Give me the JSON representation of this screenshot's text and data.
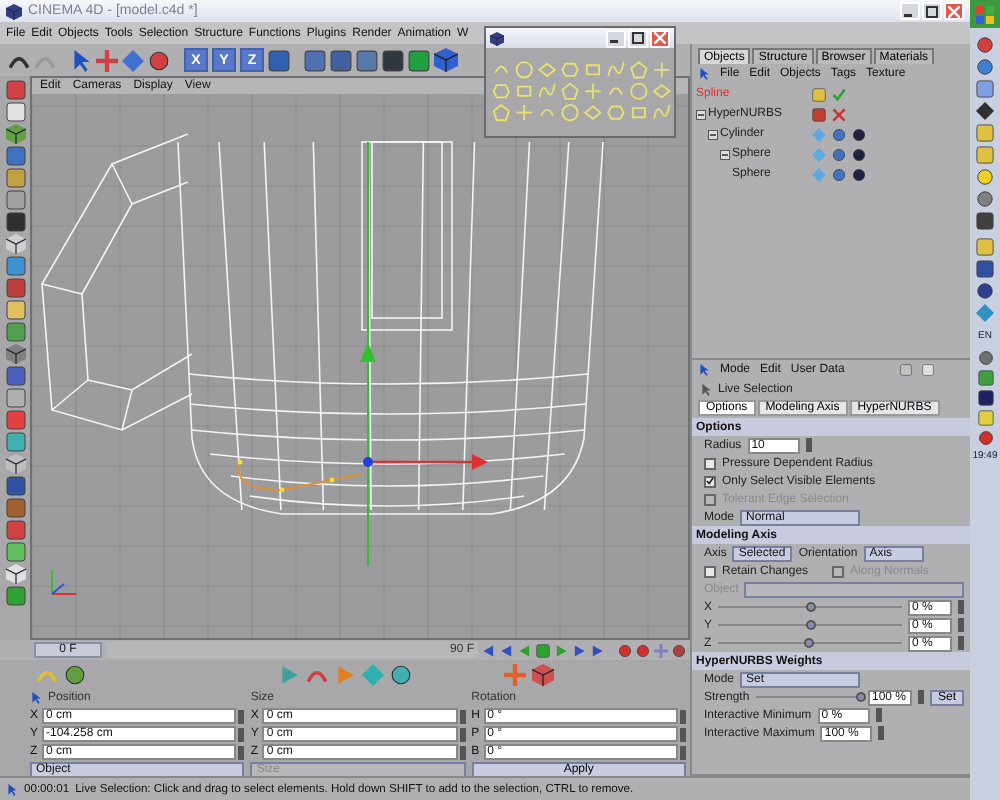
{
  "window": {
    "title": "CINEMA 4D - [model.c4d *]"
  },
  "menu": [
    "File",
    "Edit",
    "Objects",
    "Tools",
    "Selection",
    "Structure",
    "Functions",
    "Plugins",
    "Render",
    "Animation",
    "W"
  ],
  "toolbar": {
    "axis_buttons": [
      "X",
      "Y",
      "Z"
    ]
  },
  "viewport": {
    "menu": [
      "Edit",
      "Cameras",
      "Display",
      "View"
    ]
  },
  "objects_panel": {
    "tabs": [
      {
        "label": "Objects",
        "selected": true
      },
      {
        "label": "Structure",
        "selected": false
      },
      {
        "label": "Browser",
        "selected": false
      },
      {
        "label": "Materials",
        "selected": false
      }
    ],
    "menu": [
      "File",
      "Edit",
      "Objects",
      "Tags",
      "Texture"
    ],
    "tree": [
      {
        "name": "Spline",
        "selected": true,
        "enabled": true
      },
      {
        "name": "HyperNURBS",
        "selected": false,
        "enabled": false,
        "expanded": true,
        "children": [
          {
            "name": "Cylinder",
            "selected": false,
            "expanded": true,
            "children": [
              {
                "name": "Sphere",
                "selected": false,
                "expanded": true,
                "children": [
                  {
                    "name": "Sphere",
                    "selected": false
                  }
                ]
              }
            ]
          }
        ]
      }
    ]
  },
  "attributes": {
    "menu": [
      "Mode",
      "Edit",
      "User Data"
    ],
    "tool": "Live Selection",
    "tabs": [
      {
        "label": "Options",
        "selected": true
      },
      {
        "label": "Modeling Axis",
        "selected": false
      },
      {
        "label": "HyperNURBS",
        "selected": false
      }
    ],
    "sections": [
      {
        "title": "Options",
        "rows": [
          {
            "kind": "field",
            "label": "Radius",
            "value": "10",
            "disabled": false
          },
          {
            "kind": "check",
            "label": "Pressure Dependent Radius",
            "checked": false,
            "disabled": false
          },
          {
            "kind": "check",
            "label": "Only Select Visible Elements",
            "checked": true,
            "disabled": false
          },
          {
            "kind": "check",
            "label": "Tolerant Edge Selection",
            "checked": false,
            "disabled": true
          },
          {
            "kind": "dropdown",
            "label": "Mode",
            "value": "Normal",
            "disabled": false
          }
        ]
      },
      {
        "title": "Modeling Axis",
        "rows": [
          {
            "kind": "pair",
            "items": [
              {
                "label": "Axis",
                "value": "Selected"
              },
              {
                "label": "Orientation",
                "value": "Axis"
              }
            ]
          },
          {
            "kind": "checkpair",
            "items": [
              {
                "label": "Retain Changes",
                "checked": false,
                "disabled": false
              },
              {
                "label": "Along Normals",
                "checked": false,
                "disabled": true
              }
            ]
          },
          {
            "kind": "dropdown",
            "label": "Object",
            "disabled": true
          },
          {
            "kind": "slider",
            "label": "X",
            "level": 0.5,
            "value": "0 %"
          },
          {
            "kind": "slider",
            "label": "Y",
            "level": 0.5,
            "value": "0 %"
          },
          {
            "kind": "slider",
            "label": "Z",
            "level": 0.5,
            "value": "0 %"
          }
        ]
      },
      {
        "title": "HyperNURBS Weights",
        "rows": [
          {
            "kind": "dropdown",
            "label": "Mode",
            "value": "Set",
            "disabled": false
          },
          {
            "kind": "slider",
            "label": "Strength",
            "level": 1,
            "value": "100 %",
            "button": "Set"
          },
          {
            "kind": "field",
            "label": "Interactive Minimum",
            "value": "0 %",
            "disabled": false
          },
          {
            "kind": "field",
            "label": "Interactive Maximum",
            "value": "100 %",
            "disabled": false
          }
        ]
      }
    ]
  },
  "timeline": {
    "start": "0 F",
    "end": "90 F"
  },
  "coordinates": {
    "columns": [
      {
        "title": "Position",
        "rows": [
          {
            "axis": "X",
            "value": "0 cm"
          },
          {
            "axis": "Y",
            "value": "-104.258 cm"
          },
          {
            "axis": "Z",
            "value": "0 cm"
          }
        ]
      },
      {
        "title": "Size",
        "rows": [
          {
            "axis": "X",
            "value": "0 cm"
          },
          {
            "axis": "Y",
            "value": "0 cm"
          },
          {
            "axis": "Z",
            "value": "0 cm"
          }
        ]
      },
      {
        "title": "Rotation",
        "rows": [
          {
            "axis": "H",
            "value": "0 °"
          },
          {
            "axis": "P",
            "value": "0 °"
          },
          {
            "axis": "B",
            "value": "0 °"
          }
        ]
      }
    ],
    "mode": "Object",
    "size_mode": "Size",
    "apply": "Apply"
  },
  "status": {
    "time": "00:00:01",
    "message": "Live Selection: Click and drag to select elements. Hold down SHIFT to add to the selection, CTRL to remove."
  },
  "taskbar": {
    "language": "EN",
    "clock": "19:49"
  }
}
